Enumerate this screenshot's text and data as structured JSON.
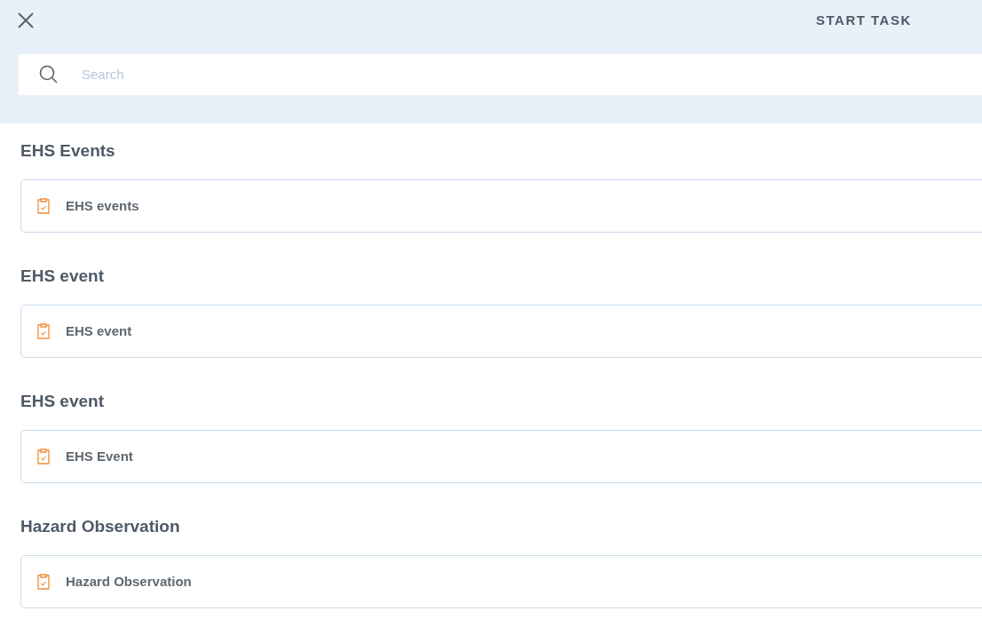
{
  "header": {
    "title": "START TASK"
  },
  "search": {
    "placeholder": "Search"
  },
  "sections": [
    {
      "heading": "EHS Events",
      "items": [
        {
          "label": "EHS events"
        }
      ]
    },
    {
      "heading": "EHS event",
      "items": [
        {
          "label": "EHS event"
        }
      ]
    },
    {
      "heading": "EHS event",
      "items": [
        {
          "label": "EHS Event"
        }
      ]
    },
    {
      "heading": "Hazard Observation",
      "items": [
        {
          "label": "Hazard Observation"
        }
      ]
    }
  ]
}
